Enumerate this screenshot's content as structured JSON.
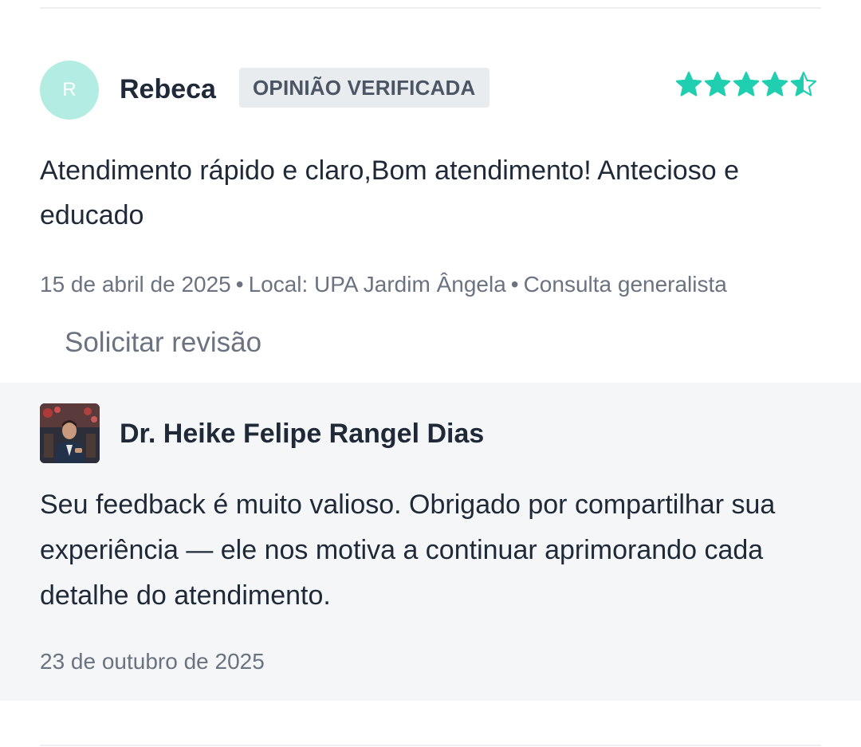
{
  "review": {
    "avatar_initial": "R",
    "reviewer_name": "Rebeca",
    "badge": "OPINIÃO VERIFICADA",
    "rating": 4.5,
    "rating_max": 5,
    "text": "Atendimento rápido e claro,Bom atendimento! Antecioso e educado",
    "date": "15 de abril de 2025",
    "location": "Local: UPA Jardim Ângela",
    "service": "Consulta generalista",
    "separator": "•",
    "request_review_label": "Solicitar revisão"
  },
  "reply": {
    "doctor_name": "Dr. Heike Felipe Rangel Dias",
    "text": "Seu feedback é muito valioso. Obrigado por compartilhar sua experiência — ele nos motiva a continuar aprimorando cada detalhe do atendimento.",
    "date": "23 de outubro de 2025"
  },
  "colors": {
    "star": "#1fcfb0",
    "avatar_bg": "#b3ece2",
    "badge_bg": "#e9ecef",
    "reply_bg": "#f5f6f8",
    "muted_text": "#6b7280",
    "text": "#1f2937"
  }
}
